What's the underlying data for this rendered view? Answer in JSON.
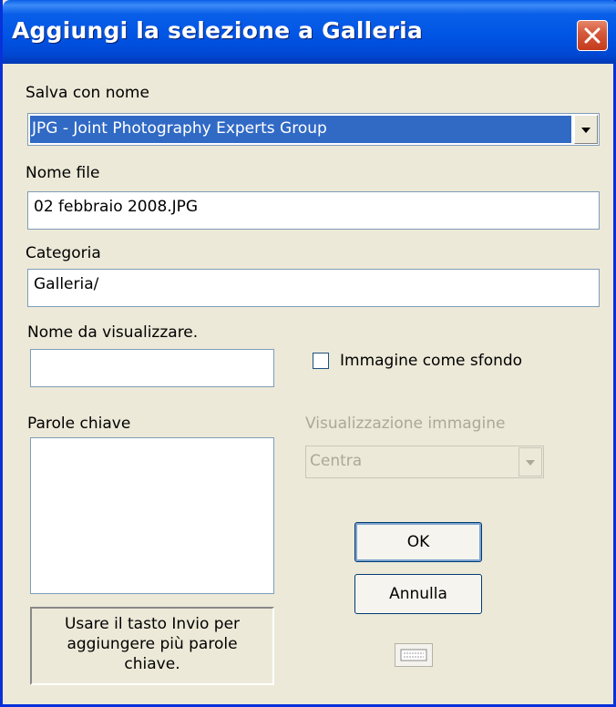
{
  "window": {
    "title": "Aggiungi la selezione a Galleria"
  },
  "save_as": {
    "label": "Salva con nome",
    "value": "JPG - Joint Photography Experts Group"
  },
  "filename": {
    "label": "Nome file",
    "value": "02 febbraio 2008.JPG"
  },
  "category": {
    "label": "Categoria",
    "value": "Galleria/"
  },
  "display_name": {
    "label": "Nome da visualizzare.",
    "value": ""
  },
  "background": {
    "label": "Immagine come sfondo",
    "checked": false
  },
  "keywords": {
    "label": "Parole chiave",
    "value": "",
    "hint": "Usare il tasto Invio per aggiungere più parole chiave."
  },
  "image_display": {
    "label": "Visualizzazione immagine",
    "value": "Centra",
    "enabled": false
  },
  "buttons": {
    "ok": "OK",
    "cancel": "Annulla"
  },
  "icons": {
    "close": "close-icon",
    "dropdown": "chevron-down-icon",
    "keyboard": "keyboard-icon"
  },
  "colors": {
    "titlebar": "#0055E5",
    "face": "#ECE9D8",
    "selection": "#316AC5",
    "close": "#D65A3C"
  }
}
